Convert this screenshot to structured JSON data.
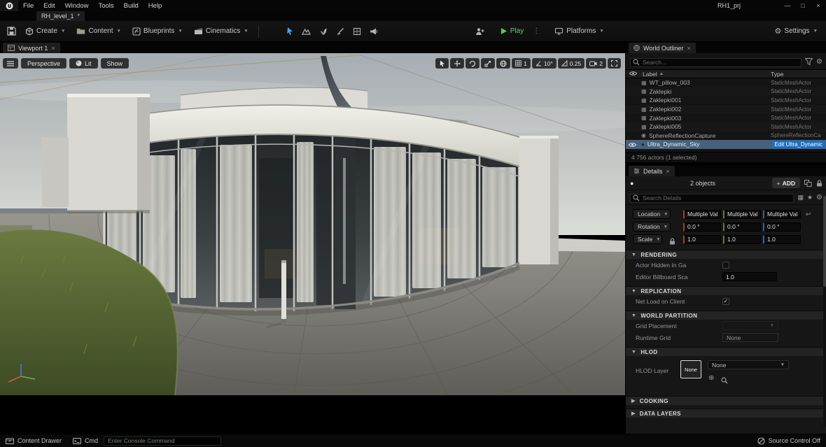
{
  "menu": {
    "items": [
      "File",
      "Edit",
      "Window",
      "Tools",
      "Build",
      "Help"
    ],
    "project_title": "RH1_prj"
  },
  "level_tab": {
    "label": "RH_level_1",
    "modified": "*"
  },
  "toolbar": {
    "create": "Create",
    "content": "Content",
    "blueprints": "Blueprints",
    "cinematics": "Cinematics",
    "play": "Play",
    "platforms": "Platforms",
    "settings": "Settings"
  },
  "viewport": {
    "tab": "Viewport 1",
    "perspective": "Perspective",
    "lit": "Lit",
    "show": "Show",
    "grid_snap": "1",
    "angle_snap": "10°",
    "scale_snap": "0.25",
    "camera_speed": "2"
  },
  "outliner": {
    "tab": "World Outliner",
    "search_placeholder": "Search...",
    "col_label": "Label",
    "col_type": "Type",
    "rows": [
      {
        "label": "WT_pillow_003",
        "type": "StaticMeshActor"
      },
      {
        "label": "Zaklepki",
        "type": "StaticMeshActor"
      },
      {
        "label": "Zaklepki001",
        "type": "StaticMeshActor"
      },
      {
        "label": "Zaklepki002",
        "type": "StaticMeshActor"
      },
      {
        "label": "Zaklepki003",
        "type": "StaticMeshActor"
      },
      {
        "label": "Zaklepki005",
        "type": "StaticMeshActor"
      },
      {
        "label": "SphereReflectionCapture",
        "type": "SphereReflectionCa"
      },
      {
        "label": "Ultra_Dynamic_Sky",
        "type": "Edit Ultra_Dynamic"
      }
    ],
    "footer": "4 756 actors (1 selected)"
  },
  "details": {
    "tab": "Details",
    "objects": "2 objects",
    "add": "ADD",
    "search_placeholder": "Search Details",
    "transform": {
      "location": "Location",
      "rotation": "Rotation",
      "scale": "Scale",
      "loc_values": [
        "Multiple Val",
        "Multiple Val",
        "Multiple Val"
      ],
      "rot_values": [
        "0.0 °",
        "0.0 °",
        "0.0 °"
      ],
      "scale_values": [
        "1.0",
        "1.0",
        "1.0"
      ]
    },
    "sections": {
      "rendering": "RENDERING",
      "replication": "REPLICATION",
      "world_partition": "WORLD PARTITION",
      "hlod": "HLOD",
      "cooking": "COOKING",
      "data_layers": "DATA LAYERS"
    },
    "fields": {
      "actor_hidden": "Actor Hidden In Ga",
      "billboard": "Editor Billboard Sca",
      "billboard_value": "1.0",
      "net_load": "Net Load on Client",
      "grid_placement": "Grid Placement",
      "runtime_grid": "Runtime Grid",
      "runtime_grid_value": "None",
      "hlod_layer": "HLOD Layer",
      "hlod_button": "None",
      "hlod_dropdown": "None"
    }
  },
  "statusbar": {
    "content_drawer": "Content Drawer",
    "cmd": "Cmd",
    "console_placeholder": "Enter Console Command",
    "source_control": "Source Control Off"
  }
}
